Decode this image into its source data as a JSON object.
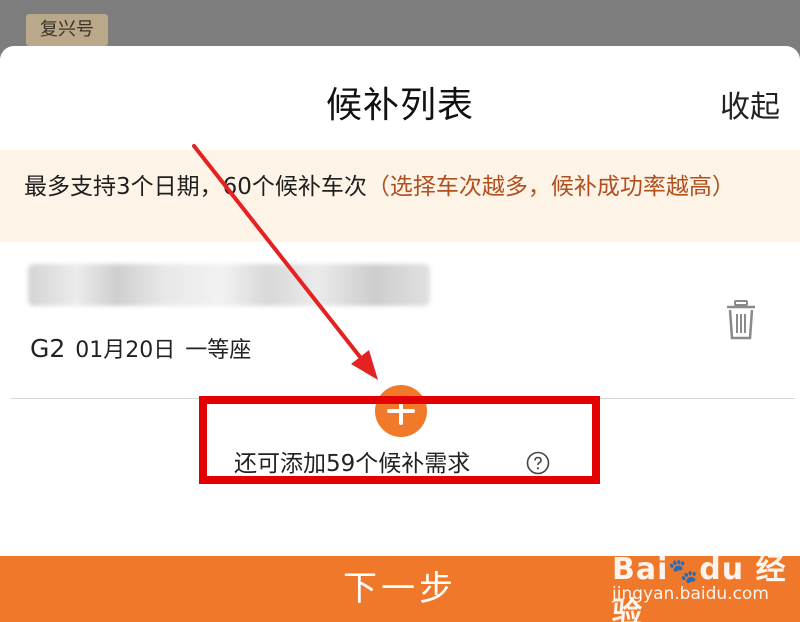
{
  "background": {
    "tag": "复兴号"
  },
  "sheet": {
    "title": "候补列表",
    "collapse_label": "收起",
    "notice": {
      "main": "最多支持3个日期，60个候补车次",
      "hint": "（选择车次越多，候补成功率越高）"
    },
    "items": [
      {
        "train": "G2",
        "date": "01月20日",
        "seat": "一等座",
        "route_blurred": true
      }
    ],
    "add": {
      "remaining_text": "还可添加59个候补需求"
    },
    "next_label": "下一步"
  },
  "watermark": {
    "logo": "Bai du 经验",
    "url": "jingyan.baidu.com"
  },
  "colors": {
    "accent": "#f07a2a",
    "highlight": "#e20000",
    "notice_bg": "#fdf3e7",
    "hint_text": "#b0501f"
  },
  "icons": [
    "trash-icon",
    "plus-icon",
    "help-icon",
    "arrow-annotation"
  ]
}
